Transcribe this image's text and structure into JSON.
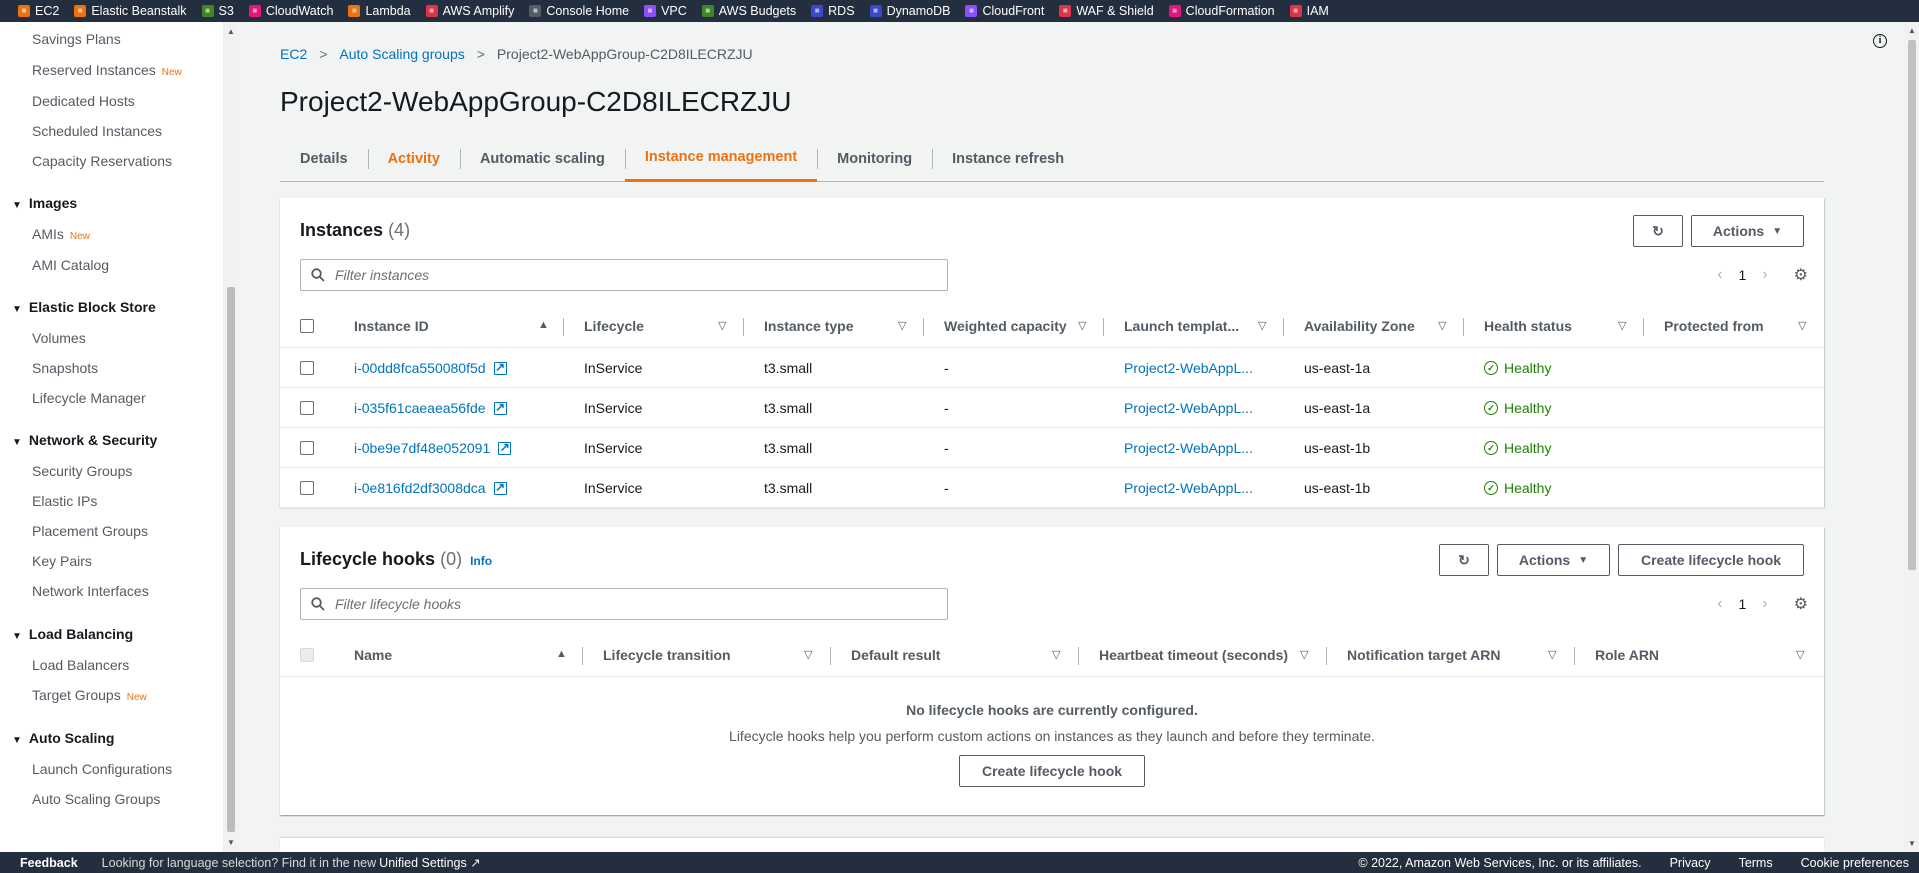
{
  "favorites": [
    {
      "label": "EC2",
      "color": "#ec7211"
    },
    {
      "label": "Elastic Beanstalk",
      "color": "#ec7211"
    },
    {
      "label": "S3",
      "color": "#3f8624"
    },
    {
      "label": "CloudWatch",
      "color": "#e7157b"
    },
    {
      "label": "Lambda",
      "color": "#ec7211"
    },
    {
      "label": "AWS Amplify",
      "color": "#dd344c"
    },
    {
      "label": "Console Home",
      "color": "#545b64"
    },
    {
      "label": "VPC",
      "color": "#8c4fff"
    },
    {
      "label": "AWS Budgets",
      "color": "#3f8624"
    },
    {
      "label": "RDS",
      "color": "#3b48cc"
    },
    {
      "label": "DynamoDB",
      "color": "#3b48cc"
    },
    {
      "label": "CloudFront",
      "color": "#8c4fff"
    },
    {
      "label": "WAF & Shield",
      "color": "#dd344c"
    },
    {
      "label": "CloudFormation",
      "color": "#e7157b"
    },
    {
      "label": "IAM",
      "color": "#dd344c"
    }
  ],
  "sidebar": {
    "items_top": [
      {
        "label": "Savings Plans",
        "badge": ""
      },
      {
        "label": "Reserved Instances",
        "badge": "New"
      },
      {
        "label": "Dedicated Hosts",
        "badge": ""
      },
      {
        "label": "Scheduled Instances",
        "badge": ""
      },
      {
        "label": "Capacity Reservations",
        "badge": ""
      }
    ],
    "images": {
      "title": "Images",
      "items": [
        {
          "label": "AMIs",
          "badge": "New"
        },
        {
          "label": "AMI Catalog",
          "badge": ""
        }
      ]
    },
    "ebs": {
      "title": "Elastic Block Store",
      "items": [
        {
          "label": "Volumes"
        },
        {
          "label": "Snapshots"
        },
        {
          "label": "Lifecycle Manager"
        }
      ]
    },
    "network": {
      "title": "Network & Security",
      "items": [
        {
          "label": "Security Groups"
        },
        {
          "label": "Elastic IPs"
        },
        {
          "label": "Placement Groups"
        },
        {
          "label": "Key Pairs"
        },
        {
          "label": "Network Interfaces"
        }
      ]
    },
    "lb": {
      "title": "Load Balancing",
      "items": [
        {
          "label": "Load Balancers",
          "badge": ""
        },
        {
          "label": "Target Groups",
          "badge": "New"
        }
      ]
    },
    "asg": {
      "title": "Auto Scaling",
      "items": [
        {
          "label": "Launch Configurations"
        },
        {
          "label": "Auto Scaling Groups"
        }
      ]
    }
  },
  "breadcrumb": [
    "EC2",
    "Auto Scaling groups",
    "Project2-WebAppGroup-C2D8ILECRZJU"
  ],
  "page_title": "Project2-WebAppGroup-C2D8ILECRZJU",
  "tabs": [
    "Details",
    "Activity",
    "Automatic scaling",
    "Instance management",
    "Monitoring",
    "Instance refresh"
  ],
  "instances": {
    "title": "Instances",
    "count": "(4)",
    "actions_label": "Actions",
    "filter_placeholder": "Filter instances",
    "page": "1",
    "columns": [
      "Instance ID",
      "Lifecycle",
      "Instance type",
      "Weighted capacity",
      "Launch templat...",
      "Availability Zone",
      "Health status",
      "Protected from"
    ],
    "rows": [
      {
        "id": "i-00dd8fca550080f5d",
        "lifecycle": "InService",
        "type": "t3.small",
        "weight": "-",
        "template": "Project2-WebAppL...",
        "az": "us-east-1a",
        "health": "Healthy",
        "protected": ""
      },
      {
        "id": "i-035f61caeaea56fde",
        "lifecycle": "InService",
        "type": "t3.small",
        "weight": "-",
        "template": "Project2-WebAppL...",
        "az": "us-east-1a",
        "health": "Healthy",
        "protected": ""
      },
      {
        "id": "i-0be9e7df48e052091",
        "lifecycle": "InService",
        "type": "t3.small",
        "weight": "-",
        "template": "Project2-WebAppL...",
        "az": "us-east-1b",
        "health": "Healthy",
        "protected": ""
      },
      {
        "id": "i-0e816fd2df3008dca",
        "lifecycle": "InService",
        "type": "t3.small",
        "weight": "-",
        "template": "Project2-WebAppL...",
        "az": "us-east-1b",
        "health": "Healthy",
        "protected": ""
      }
    ]
  },
  "hooks": {
    "title": "Lifecycle hooks",
    "count": "(0)",
    "info": "Info",
    "actions_label": "Actions",
    "create_label": "Create lifecycle hook",
    "filter_placeholder": "Filter lifecycle hooks",
    "page": "1",
    "columns": [
      "Name",
      "Lifecycle transition",
      "Default result",
      "Heartbeat timeout (seconds)",
      "Notification target ARN",
      "Role ARN"
    ],
    "empty_title": "No lifecycle hooks are currently configured.",
    "empty_desc": "Lifecycle hooks help you perform custom actions on instances as they launch and before they terminate.",
    "empty_button": "Create lifecycle hook"
  },
  "footer": {
    "feedback": "Feedback",
    "message": "Looking for language selection? Find it in the new",
    "link": "Unified Settings",
    "copyright": "© 2022, Amazon Web Services, Inc. or its affiliates.",
    "privacy": "Privacy",
    "terms": "Terms",
    "cookies": "Cookie preferences"
  }
}
